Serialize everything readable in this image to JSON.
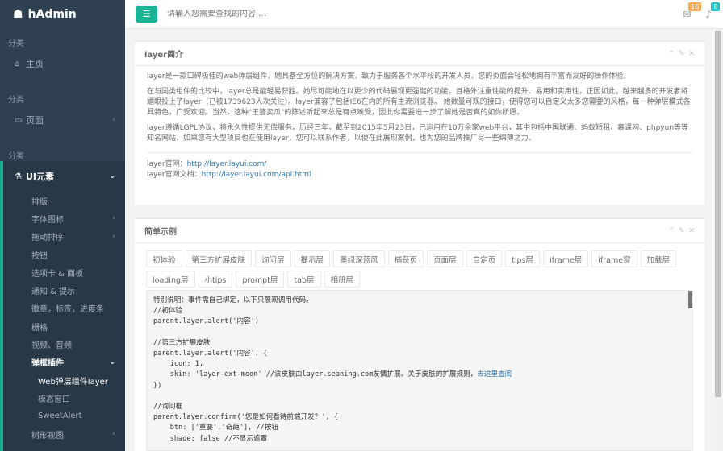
{
  "app": {
    "logo_text": "hAdmin"
  },
  "sidebar": {
    "section1": "分类",
    "home": "主页",
    "section2": "分类",
    "pages": "页面",
    "section3": "分类",
    "ui_group": "UI元素",
    "sub_items": [
      "排版",
      "字体图标",
      "拖动排序",
      "按钮",
      "选项卡 & 面板",
      "通知 & 提示",
      "徽章，标签，进度条",
      "栅格",
      "视频、音频",
      "弹框插件"
    ],
    "sub_arrows": [
      false,
      true,
      true,
      false,
      false,
      false,
      false,
      false,
      false,
      true
    ],
    "popup_items": [
      "Web弹层组件layer",
      "模态窗口",
      "SweetAlert"
    ],
    "tree_view": "树形视图"
  },
  "topbar": {
    "search_placeholder": "请输入您需要查找的内容 …",
    "mail_count": "16",
    "bell_count": "8"
  },
  "panel1": {
    "title": "layer简介",
    "p1": "layer是一款口碑极佳的web弹层组件，她具备全方位的解决方案，致力于服务各个水平段的开发人员，您的页面会轻松地拥有丰富而友好的操作体验。",
    "p2": "在与同类组件的比较中，layer总是能轻易获胜。她尽可能地在以更少的代码展现更强健的功能，且格外注重性能的提升、易用和实用性，正因如此，越来越多的开发者将媚眼投上了layer（已被1739623人次关注）。layer兼容了包括IE6在内的所有主流浏览器。 她数量可观的接口，使得您可以自定义太多您需要的风格，每一种弹层模式各具特色，广受欢迎。当然，这种\"王婆卖瓜\"的陈述听起来总是有点难受，因此你需要进一步了解她是否真的如你所愿。",
    "p3": "layer遵循LGPL协议，将永久性提供无偿服务。历经三年，截至到2015年5月23日，已运用在10万余家web平台，其中包括中国联通、蚂蚁短租、慕课网、phpyun等等知名网站，如果您有大型项目也在使用layer，您可以联系作者，以便在此展现案例，也为您的品牌推广尽一些绵薄之力。",
    "site_label": "layer官网：",
    "site_url": "http://layer.layui.com/",
    "doc_label": "layer官网文档：",
    "doc_url": "http://layer.layui.com/api.html"
  },
  "panel2": {
    "title": "简单示例",
    "buttons": [
      "初体验",
      "第三方扩展皮肤",
      "询问层",
      "提示层",
      "墨绿深蓝风",
      "捕获页",
      "页面层",
      "自定页",
      "tips层",
      "iframe层",
      "iframe窗",
      "加载层",
      "loading层",
      "小tips",
      "prompt层",
      "tab层",
      "相册层"
    ]
  },
  "code": {
    "l1": "特别说明：事件需自己绑定，以下只展现调用代码。",
    "l2": "//初体验",
    "l3": "parent.layer.alert('内容')",
    "l4": "",
    "l5": "//第三方扩展皮肤",
    "l6": "parent.layer.alert('内容', {",
    "l7": "    icon: 1,",
    "l8a": "    skin: 'layer-ext-moon' //该皮肤由layer.seaning.com友情扩展。关于皮肤的扩展规则，",
    "l8b": "去这里查阅",
    "l9": "})",
    "l10": "",
    "l11": "//询问框",
    "l12": "parent.layer.confirm('您是如何看待前端开发？', {",
    "l13": "    btn: ['重要','奇葩'], //按钮",
    "l14": "    shade: false //不显示遮罩"
  }
}
